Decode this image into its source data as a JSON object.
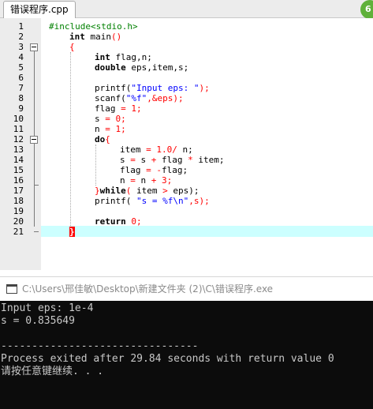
{
  "editor": {
    "tab_label": "错误程序.cpp",
    "badge": "6",
    "line_numbers": [
      "1",
      "2",
      "3",
      "4",
      "5",
      "6",
      "7",
      "8",
      "9",
      "10",
      "11",
      "12",
      "13",
      "14",
      "15",
      "16",
      "17",
      "18",
      "19",
      "20",
      "21"
    ],
    "code": {
      "l1": "#include<stdio.h>",
      "l2_kw": "int",
      "l2_rest": " main",
      "l2_paren": "()",
      "l3": "{",
      "l4_kw": "int",
      "l4_rest": " flag,n;",
      "l5_kw": "double",
      "l5_rest": " eps,item,s;",
      "l7_fn": "printf(",
      "l7_str": "\"Input eps: \"",
      "l7_end": ");",
      "l8_fn": "scanf(",
      "l8_str": "\"%f\"",
      "l8_end": ",&eps);",
      "l9_var": "flag ",
      "l9_op": "= 1;",
      "l10_var": "s ",
      "l10_op": "= 0;",
      "l11_var": "n ",
      "l11_op": "= 1;",
      "l12_kw": "do",
      "l12_brace": "{",
      "l13_var": "item ",
      "l13_op": "= 1.0/ ",
      "l13_end": "n;",
      "l14_a": "s ",
      "l14_b": "= ",
      "l14_c": "s ",
      "l14_d": "+ ",
      "l14_e": "flag ",
      "l14_f": "* ",
      "l14_g": "item;",
      "l15_a": "flag ",
      "l15_b": "= -",
      "l15_c": "flag;",
      "l16_a": "n ",
      "l16_b": "= ",
      "l16_c": "n ",
      "l16_d": "+ 3;",
      "l17_brace": "}",
      "l17_kw": "while",
      "l17_p1": "( ",
      "l17_mid": "item ",
      "l17_gt": "> ",
      "l17_end": "eps);",
      "l18_fn": "printf( ",
      "l18_str": "\"s = %f\\n\"",
      "l18_end": ",s);",
      "l20_kw": "return",
      "l20_rest": " 0;",
      "l21": "}"
    }
  },
  "console": {
    "title": "C:\\Users\\邢佳敏\\Desktop\\新建文件夹 (2)\\C\\错误程序.exe",
    "lines": [
      "Input eps: 1e-4",
      "s = 0.835649",
      "",
      "--------------------------------",
      "Process exited after 29.84 seconds with return value 0",
      "请按任意键继续. . ."
    ]
  },
  "colors": {
    "preprocessor": "#008000",
    "string": "#0000ff",
    "number_operator": "#ff0000",
    "current_line": "#ccffff",
    "console_bg": "#0c0c0c",
    "console_text": "#c8c8c8"
  }
}
